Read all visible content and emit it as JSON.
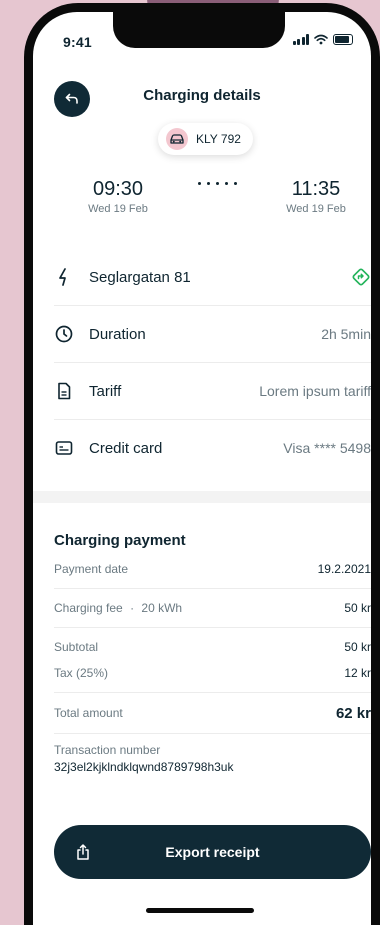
{
  "status": {
    "time": "9:41"
  },
  "header": {
    "title": "Charging details",
    "back_icon": "arrow-back-icon"
  },
  "vehicle": {
    "plate": "KLY 792",
    "icon": "car-icon",
    "icon_bg": "#f3c7cf"
  },
  "session": {
    "start": {
      "time": "09:30",
      "date": "Wed 19 Feb"
    },
    "end": {
      "time": "11:35",
      "date": "Wed 19 Feb"
    }
  },
  "details": [
    {
      "label": "Seglargatan 81",
      "value": "",
      "icon": "lightning-icon",
      "action_icon": "directions-icon"
    },
    {
      "label": "Duration",
      "value": "2h 5min",
      "icon": "clock-icon"
    },
    {
      "label": "Tariff",
      "value": "Lorem ipsum tariff",
      "icon": "document-icon"
    },
    {
      "label": "Credit card",
      "value": "Visa **** 5498",
      "icon": "credit-card-icon"
    }
  ],
  "payment": {
    "title": "Charging payment",
    "payment_date_label": "Payment date",
    "payment_date_value": "19.2.2021",
    "fee_label": "Charging fee",
    "fee_energy": "20 kWh",
    "fee_value": "50 kr",
    "subtotal_label": "Subtotal",
    "subtotal_value": "50 kr",
    "tax_label": "Tax (25%)",
    "tax_value": "12 kr",
    "total_label": "Total amount",
    "total_value": "62 kr",
    "transaction_label": "Transaction number",
    "transaction_value": "32j3el2kjklndklqwnd8789798h3uk"
  },
  "footer": {
    "export_label": "Export receipt",
    "export_icon": "share-icon"
  },
  "colors": {
    "primary": "#102a36",
    "accent_green": "#22b35a",
    "background": "#e6c6d0"
  }
}
